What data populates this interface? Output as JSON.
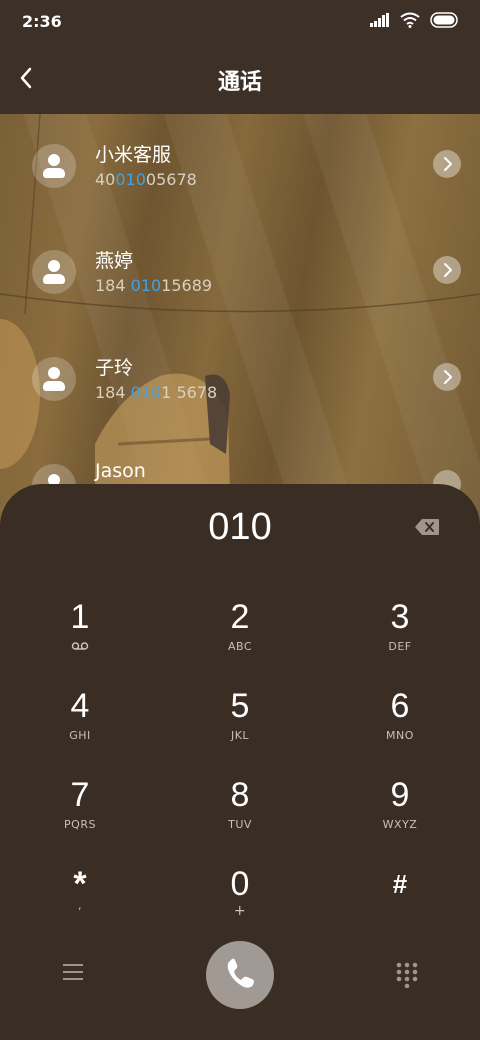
{
  "status_bar": {
    "time": "2:36"
  },
  "header": {
    "title": "通话"
  },
  "contacts": [
    {
      "name": "小米客服",
      "num_pre": "40",
      "num_hl": "010",
      "num_post": "05678"
    },
    {
      "name": "燕婷",
      "num_pre": "184 ",
      "num_hl": "010",
      "num_post": "15689"
    },
    {
      "name": "子玲",
      "num_pre": "184 ",
      "num_hl": "010",
      "num_post": "1 5678"
    },
    {
      "name": "Jason"
    }
  ],
  "dialpad": {
    "input": "010",
    "keys": [
      {
        "digit": "1",
        "letters": ""
      },
      {
        "digit": "2",
        "letters": "ABC"
      },
      {
        "digit": "3",
        "letters": "DEF"
      },
      {
        "digit": "4",
        "letters": "GHI"
      },
      {
        "digit": "5",
        "letters": "JKL"
      },
      {
        "digit": "6",
        "letters": "MNO"
      },
      {
        "digit": "7",
        "letters": "PQRS"
      },
      {
        "digit": "8",
        "letters": "TUV"
      },
      {
        "digit": "9",
        "letters": "WXYZ"
      },
      {
        "digit": "*",
        "letters": ","
      },
      {
        "digit": "0",
        "letters": "+"
      },
      {
        "digit": "#",
        "letters": ""
      }
    ]
  },
  "icons": {
    "back": "chevron-left-icon",
    "backspace": "backspace-icon",
    "call": "phone-icon",
    "menu": "menu-icon",
    "keypad": "dialpad-icon",
    "voicemail": "voicemail-icon"
  }
}
